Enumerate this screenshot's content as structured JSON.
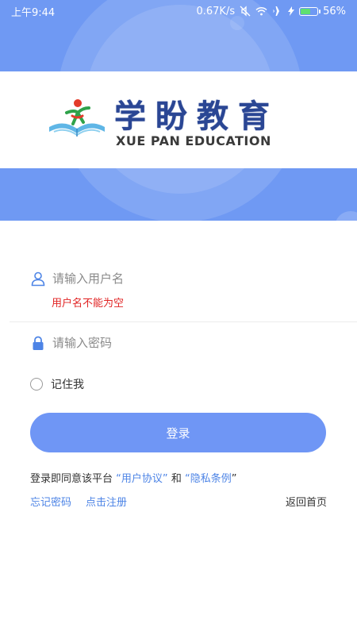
{
  "status_bar": {
    "time": "上午9:44",
    "net_speed": "0.67K/s",
    "battery_percent": "56%",
    "battery_level": 0.56,
    "icons": [
      "mute-icon",
      "wifi-icon",
      "airplane-icon",
      "charging-icon",
      "battery-icon"
    ]
  },
  "brand": {
    "name_cn": "学盼教育",
    "name_en": "XUE PAN EDUCATION"
  },
  "form": {
    "username": {
      "placeholder": "请输入用户名",
      "value": "",
      "error": "用户名不能为空"
    },
    "password": {
      "placeholder": "请输入密码",
      "value": ""
    },
    "remember_label": "记住我",
    "remember_checked": false,
    "login_label": "登录"
  },
  "agreement": {
    "prefix": "登录即同意该平台",
    "q1": "“",
    "user_agreement": "用户协议",
    "q2": "”",
    "and": "和",
    "q3": "“",
    "privacy": "隐私条例",
    "q4": "”"
  },
  "links": {
    "forgot": "忘记密码",
    "register": "点击注册",
    "home": "返回首页"
  },
  "colors": {
    "header_blue": "#6f99f3",
    "button_blue": "#6f96f5",
    "link_blue": "#4d84e6",
    "error_red": "#e12424",
    "brand_navy": "#2a4694"
  }
}
